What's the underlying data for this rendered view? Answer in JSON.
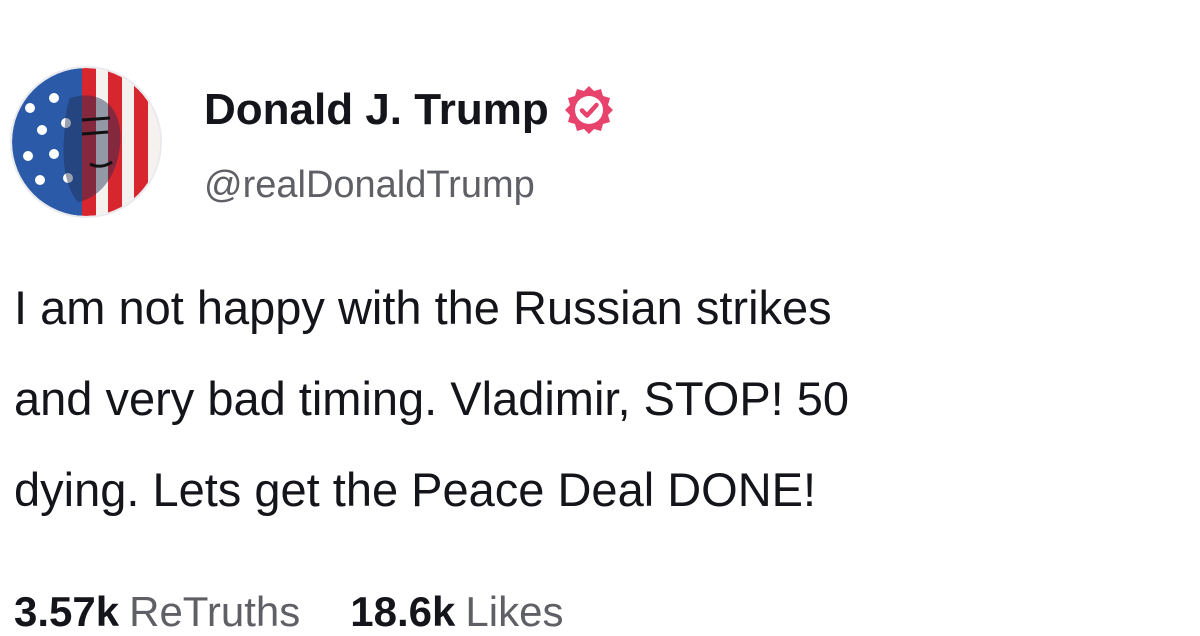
{
  "post": {
    "author": {
      "display_name": "Donald J. Trump",
      "handle": "@realDonaldTrump",
      "verified_icon": "verified-badge-icon",
      "badge_color": "#e8436c"
    },
    "body_lines": [
      "I am not happy with the Russian strikes",
      "and very bad timing. Vladimir, STOP! 50",
      "dying. Lets get the Peace Deal DONE!"
    ],
    "stats": {
      "retruths_count": "3.57k",
      "retruths_label": "ReTruths",
      "likes_count": "18.6k",
      "likes_label": "Likes"
    }
  }
}
